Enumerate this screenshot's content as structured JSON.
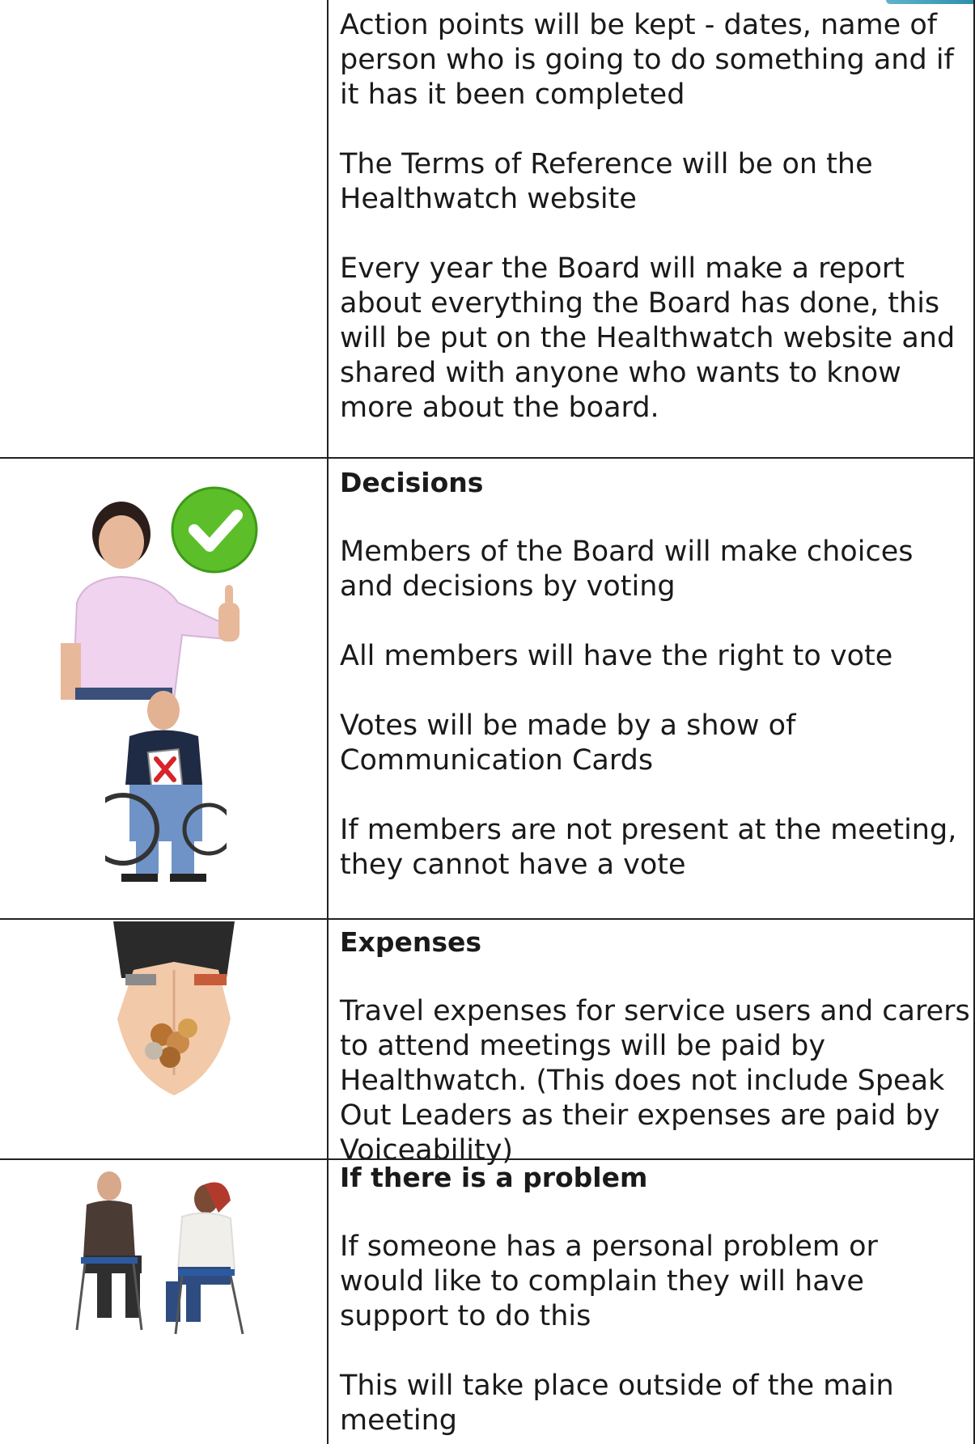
{
  "rows": [
    {
      "id": "intro",
      "paragraphs": [
        "Action points will be kept - dates, name of person who is going to do something and if it has it been completed",
        "The Terms of Reference will be on the Healthwatch website",
        "Every year the Board will make a report about everything the Board has done, this will be put on the Healthwatch website and shared with anyone who wants to know more about the board."
      ]
    },
    {
      "id": "decisions",
      "heading": "Decisions",
      "paragraphs": [
        "Members of the Board will make choices and decisions by voting",
        "All members will have the right to vote",
        "Votes will be made by a show of Communication Cards",
        "If members are not present at the meeting, they cannot have a vote"
      ]
    },
    {
      "id": "expenses",
      "heading": "Expenses",
      "paragraphs": [
        "Travel expenses for service users and carers to attend meetings will be paid by Healthwatch.  (This does not include Speak Out Leaders as their expenses are paid by Voiceability)"
      ]
    },
    {
      "id": "problem",
      "heading": "If there is a problem",
      "paragraphs": [
        "If someone has a personal problem or would like to complain they will have support to do this",
        "This will take place outside of the main meeting"
      ]
    }
  ],
  "colors": {
    "border": "#222222",
    "check_green": "#5cbf2a",
    "cross_red": "#d8232a",
    "shirt_pink": "#efd3ef"
  },
  "icons": [
    "thumbs-up-check-icon",
    "wheelchair-vote-no-icon",
    "coins-in-hands-icon",
    "two-people-talking-icon"
  ]
}
